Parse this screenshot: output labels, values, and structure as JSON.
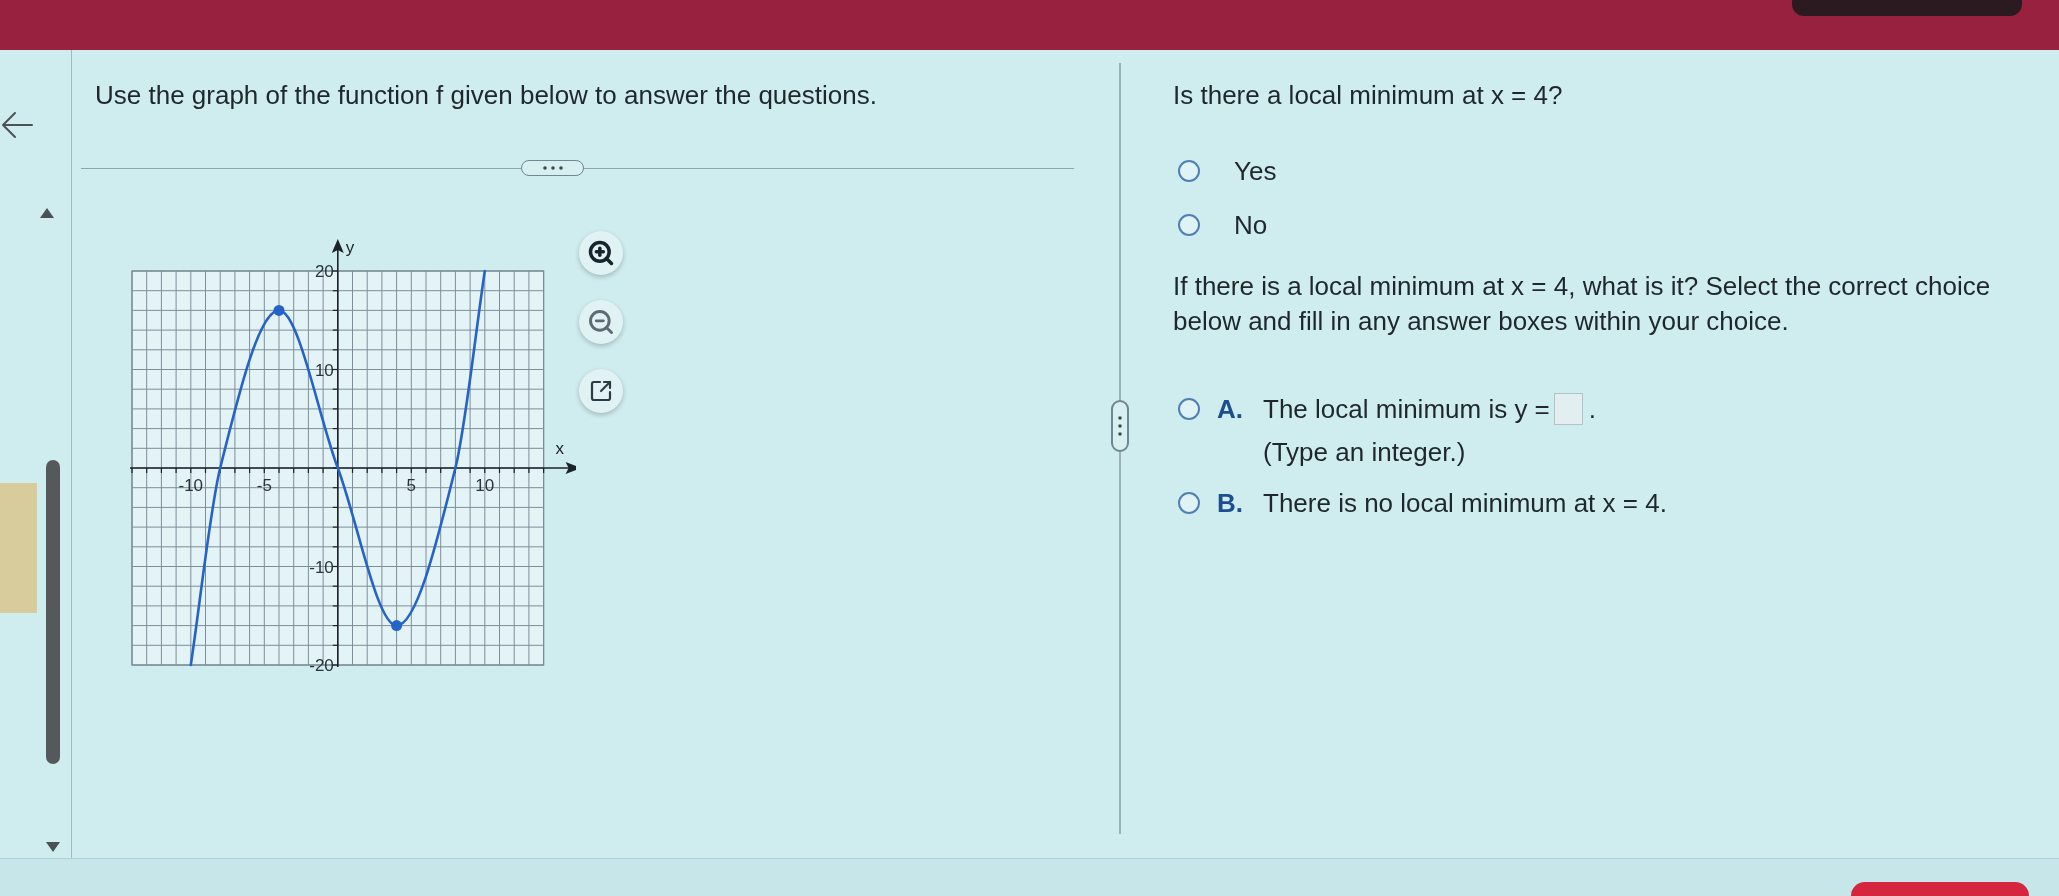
{
  "instruction": "Use the graph of the function f given below to answer the questions.",
  "graph": {
    "chart_data": {
      "type": "line",
      "xlabel": "x",
      "ylabel": "y",
      "x": [
        -10,
        -8,
        -4,
        0,
        4,
        8,
        10
      ],
      "series": [
        {
          "color": "#2563c9",
          "values": [
            -20,
            0,
            16,
            0,
            -16,
            0,
            20
          ]
        }
      ],
      "xlim": [
        -14,
        14
      ],
      "ylim": [
        -20,
        20
      ],
      "xticks": [
        -10,
        -5,
        5,
        10
      ],
      "yticks": [
        -20,
        -10,
        10,
        20
      ],
      "grid": true
    }
  },
  "question": "Is there a local minimum at x = 4?",
  "options": [
    {
      "label": "Yes",
      "selected": false
    },
    {
      "label": "No",
      "selected": false
    }
  ],
  "prompt": "If there is a local minimum at x = 4, what is it? Select the correct choice below and fill in any answer boxes within your choice.",
  "choices": [
    {
      "kind": "answer",
      "letter": "A.",
      "text": "The local minimum is y =",
      "suffix": ".",
      "hint": "(Type an integer.)",
      "selected": false
    },
    {
      "kind": "statement",
      "letter": "B.",
      "text": "There is no local minimum at x = 4.",
      "selected": false
    }
  ]
}
